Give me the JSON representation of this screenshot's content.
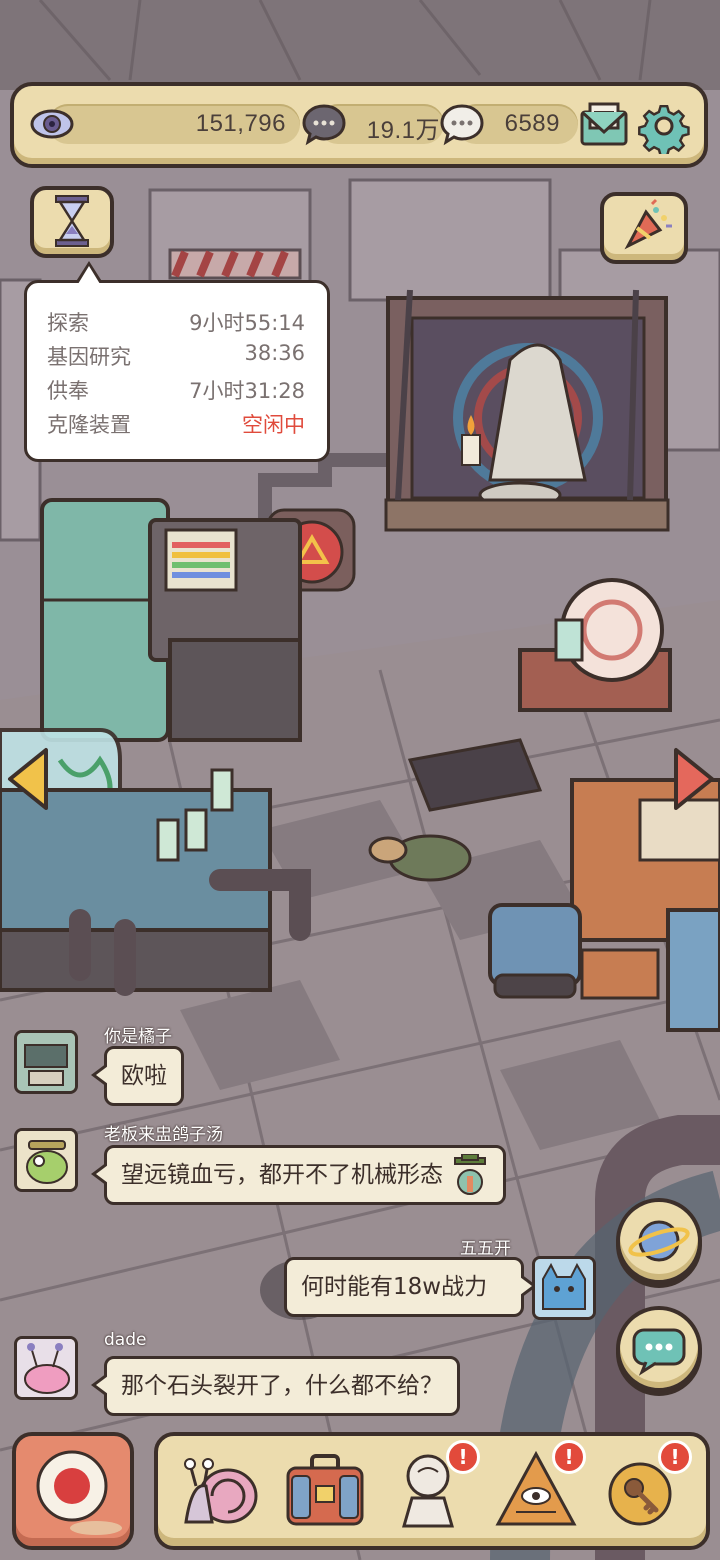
{
  "resources": {
    "eye": "151,796",
    "dark_bubble": "19.1万",
    "light_bubble": "6589"
  },
  "timers": [
    {
      "label": "探索",
      "value": "9小时55:14",
      "idle": false
    },
    {
      "label": "基因研究",
      "value": "38:36",
      "idle": false
    },
    {
      "label": "供奉",
      "value": "7小时31:28",
      "idle": false
    },
    {
      "label": "克隆装置",
      "value": "空闲中",
      "idle": true
    }
  ],
  "chat": [
    {
      "name": "你是橘子",
      "text": "欧啦",
      "side": "left"
    },
    {
      "name": "老板来盅鸽子汤",
      "text": "望远镜血亏，都开不了机械形态",
      "side": "left"
    },
    {
      "name": "五五开",
      "text": "何时能有18w战力",
      "side": "right"
    },
    {
      "name": "dade",
      "text": "那个石头裂开了，什么都不给？",
      "side": "left"
    }
  ],
  "bottom_nav": [
    {
      "icon": "snail-icon",
      "badge": ""
    },
    {
      "icon": "suitcase-icon",
      "badge": "!"
    },
    {
      "icon": "bust-statue-icon",
      "badge": "!"
    },
    {
      "icon": "pyramid-eye-icon",
      "badge": "!"
    },
    {
      "icon": "key-icon",
      "badge": "!"
    }
  ],
  "colors": {
    "panel": "#ecdcae",
    "outline": "#3c2f2a",
    "idle_red": "#e04b3c",
    "badge_red": "#e24a3b"
  }
}
